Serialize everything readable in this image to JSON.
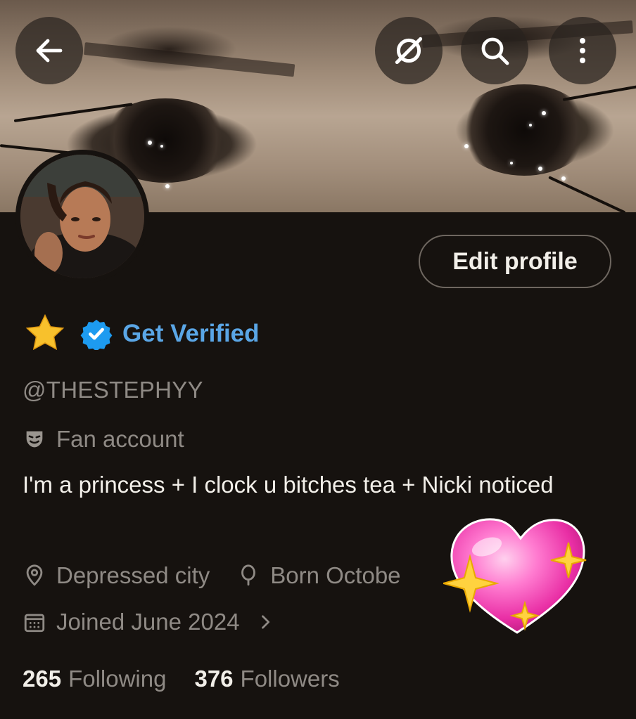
{
  "header": {
    "back_icon": "arrow-left-icon",
    "grok_icon": "grok-icon",
    "search_icon": "search-icon",
    "more_icon": "more-vertical-icon"
  },
  "profile": {
    "edit_button": "Edit profile",
    "name_emoji": "star-emoji",
    "verified_label": "Get Verified",
    "handle": "@THESTEPHYY",
    "category": "Fan account",
    "bio": "I'm a princess + I clock u bitches tea + Nicki noticed",
    "location": "Depressed city",
    "birthday": "Born Octobe",
    "joined": "Joined June 2024",
    "following_count": "265",
    "following_label": "Following",
    "followers_count": "376",
    "followers_label": "Followers"
  },
  "colors": {
    "background": "#16120f",
    "accent_blue": "#5aa6e6",
    "secondary_text": "#8f8a85",
    "verified_badge": "#1d9bf0"
  }
}
